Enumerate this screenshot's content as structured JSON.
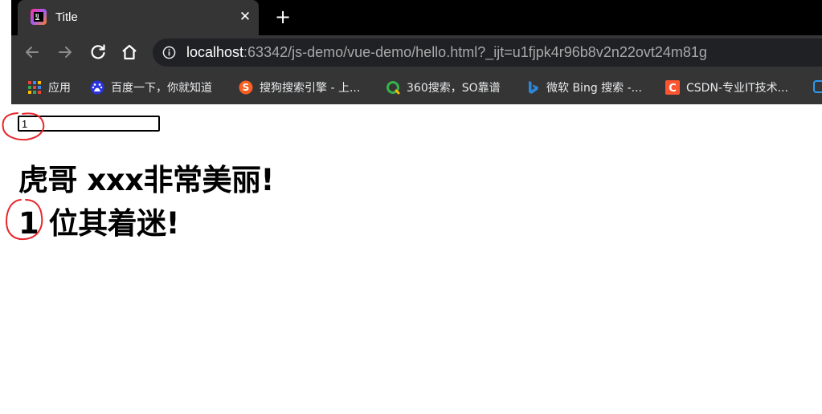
{
  "browser": {
    "tab": {
      "title": "Title",
      "close_glyph": "✕",
      "favicon": "intellij-icon"
    },
    "new_tab_glyph": "+",
    "toolbar": {
      "back_icon": "back-arrow-icon",
      "forward_icon": "forward-arrow-icon",
      "reload_icon": "reload-icon",
      "home_icon": "home-icon",
      "url_host": "localhost",
      "url_rest": ":63342/js-demo/vue-demo/hello.html?_ijt=u1fjpk4r96b8v2n22ovt24m81g"
    },
    "bookmarks": [
      {
        "label": "应用",
        "icon": "apps-grid-icon",
        "color": "#4285f4"
      },
      {
        "label": "百度一下，你就知道",
        "icon": "baidu-icon",
        "color": "#2932e1"
      },
      {
        "label": "搜狗搜索引擎 - 上...",
        "icon": "sogou-icon",
        "color": "#fb6022"
      },
      {
        "label": "360搜索，SO靠谱",
        "icon": "so360-icon",
        "color": "#35b34a"
      },
      {
        "label": "微软 Bing 搜索 -...",
        "icon": "bing-icon",
        "color": "#2b88d8"
      },
      {
        "label": "CSDN-专业IT技术...",
        "icon": "csdn-icon",
        "color": "#fc5531"
      }
    ]
  },
  "page": {
    "input_value": "1",
    "heading1": "虎哥 xxx非常美丽!",
    "heading2": "1 位其着迷!"
  },
  "colors": {
    "annotation": "#e8262d",
    "chrome_dark": "#353535",
    "tabstrip": "#000000"
  }
}
